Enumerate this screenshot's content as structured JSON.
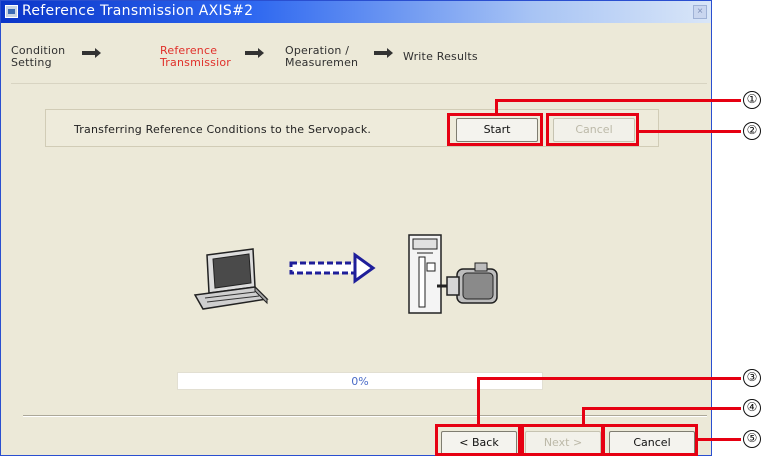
{
  "window": {
    "title": "Reference Transmission AXIS#2",
    "close_label": "×"
  },
  "steps": [
    {
      "label": "Condition\nSetting",
      "active": false
    },
    {
      "label": "Reference\nTransmissior",
      "active": true
    },
    {
      "label": "Operation /\nMeasuremen",
      "active": false
    },
    {
      "label": "Write Results",
      "active": false
    }
  ],
  "transfer": {
    "label": "Transferring Reference Conditions to the Servopack.",
    "start_label": "Start",
    "cancel_label": "Cancel"
  },
  "progress": {
    "text": "0%",
    "value": 0
  },
  "footer": {
    "back_label": "< Back",
    "next_label": "Next >",
    "cancel_label": "Cancel"
  },
  "callouts": [
    "①",
    "②",
    "③",
    "④",
    "⑤"
  ],
  "colors": {
    "highlight": "#e60012",
    "active_step": "#e0302a",
    "title_bar": "#0a35c8",
    "dialog_bg": "#ece9d8",
    "progress_text": "#4b6cc7"
  },
  "icons": {
    "arrow": "right-arrow",
    "laptop": "laptop-icon",
    "transfer": "transfer-arrow-icon",
    "servopack": "servopack-icon",
    "motor": "servomotor-icon"
  }
}
